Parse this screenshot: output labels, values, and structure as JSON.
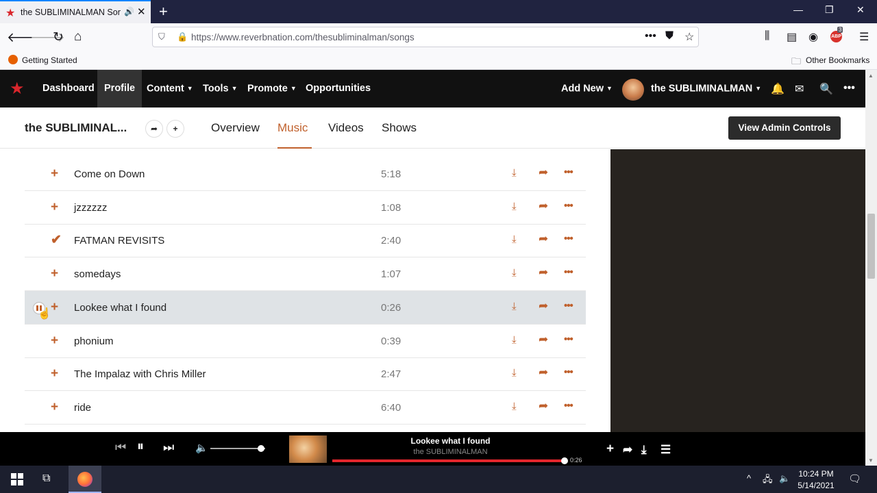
{
  "browser": {
    "tab_title": "the SUBLIMINALMAN Songs",
    "url": "https://www.reverbnation.com/thesubliminalman/songs",
    "bookmarks": {
      "getting_started": "Getting Started",
      "other": "Other Bookmarks"
    },
    "abp_count": "3",
    "abp_label": "ABP"
  },
  "site": {
    "nav": {
      "dashboard": "Dashboard",
      "profile": "Profile",
      "content": "Content",
      "tools": "Tools",
      "promote": "Promote",
      "opportunities": "Opportunities",
      "add_new": "Add New",
      "user_name": "the SUBLIMINALMAN"
    },
    "subheader": {
      "artist_name": "the SUBLIMINAL...",
      "tabs": [
        "Overview",
        "Music",
        "Videos",
        "Shows"
      ],
      "active_tab": "Music",
      "admin_button": "View Admin Controls"
    }
  },
  "songs": [
    {
      "title": "Come on Down",
      "duration": "5:18",
      "added": false
    },
    {
      "title": "jzzzzzz",
      "duration": "1:08",
      "added": false
    },
    {
      "title": "FATMAN REVISITS",
      "duration": "2:40",
      "added": true
    },
    {
      "title": "somedays",
      "duration": "1:07",
      "added": false
    },
    {
      "title": "Lookee what I found",
      "duration": "0:26",
      "added": false,
      "playing": true
    },
    {
      "title": "phonium",
      "duration": "0:39",
      "added": false
    },
    {
      "title": "The Impalaz with Chris Miller",
      "duration": "2:47",
      "added": false
    },
    {
      "title": "ride",
      "duration": "6:40",
      "added": false
    }
  ],
  "player": {
    "title": "Lookee what I found",
    "artist": "the SUBLIMINALMAN",
    "time": "0:26",
    "progress": 0.99,
    "volume": 0.93
  },
  "taskbar": {
    "time": "10:24 PM",
    "date": "5/14/2021"
  },
  "colors": {
    "accent": "#c0602c",
    "brand_red": "#d9262c",
    "progress_red": "#e3262d"
  }
}
